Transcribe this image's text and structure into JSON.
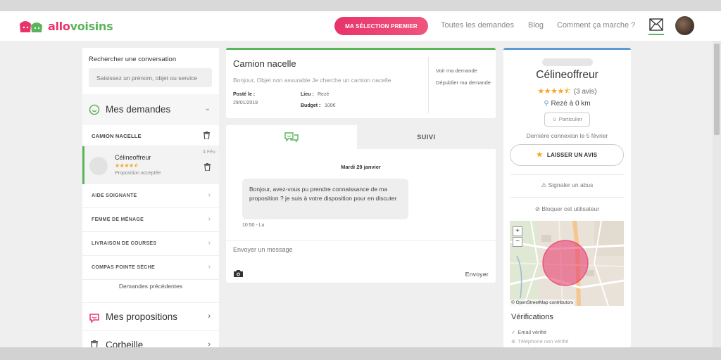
{
  "navbar": {
    "logo": "allovoisins",
    "premium_button": "MA SÉLECTION PREMIER",
    "links": [
      "Toutes les demandes",
      "Blog",
      "Comment ça marche ?"
    ]
  },
  "left": {
    "search_title": "Rechercher une conversation",
    "search_placeholder": "Saisissez un prénom, objet ou service",
    "mes_demandes": "Mes demandes",
    "camion": "CAMION NACELLE",
    "conversation": {
      "name": "Célineoffreur",
      "rating": 4.5,
      "status": "Proposition acceptée",
      "date": "4 Fév."
    },
    "items": [
      "AIDE SOIGNANTE",
      "FEMME DE MÉNAGE",
      "LIVRAISON DE COURSES",
      "COMPAS POINTE SÈCHE"
    ],
    "previous": "Demandes précédentes",
    "mes_propositions": "Mes propositions",
    "corbeille": "Corbeille"
  },
  "request": {
    "title": "Camion nacelle",
    "description": "Bonjour, Objet non assurable Je cherche un camion nacelle",
    "posted_label": "Posté le :",
    "posted_date": "29/01/2019",
    "lieu_label": "Lieu :",
    "lieu_value": "Rezé",
    "budget_label": "Budget :",
    "budget_value": "100€",
    "link_view": "Voir ma demande",
    "link_republish": "Dépublier ma demande"
  },
  "chat": {
    "tab_suivi": "SUIVI",
    "date": "Mardi 29 janvier",
    "message": "Bonjour, avez-vous pu prendre connaissance de ma proposition ? je suis à votre disposition pour en discuter",
    "time": "10:50 - Lu",
    "input_placeholder": "Envoyer un message",
    "send": "Envoyer"
  },
  "profile": {
    "name": "Célineoffreur",
    "rating": 4.5,
    "reviews": "(3 avis)",
    "location": "Rezé à 0 km",
    "badge": "Particulier",
    "last_login": "Dernière connexion le 5 février",
    "review_button": "LAISSER UN AVIS",
    "report": "Signaler un abus",
    "block": "Bloquer cet utilisateur",
    "map_attribution": "© OpenStreetMap contributors",
    "verifications_title": "Vérifications",
    "verifications": [
      {
        "label": "Email vérifié",
        "verified": true
      },
      {
        "label": "Téléphone non vérifié",
        "verified": false
      }
    ]
  },
  "colors": {
    "green": "#5ab45a",
    "pink": "#e8336a",
    "blue": "#5b9bd5",
    "star": "#f5a623"
  }
}
